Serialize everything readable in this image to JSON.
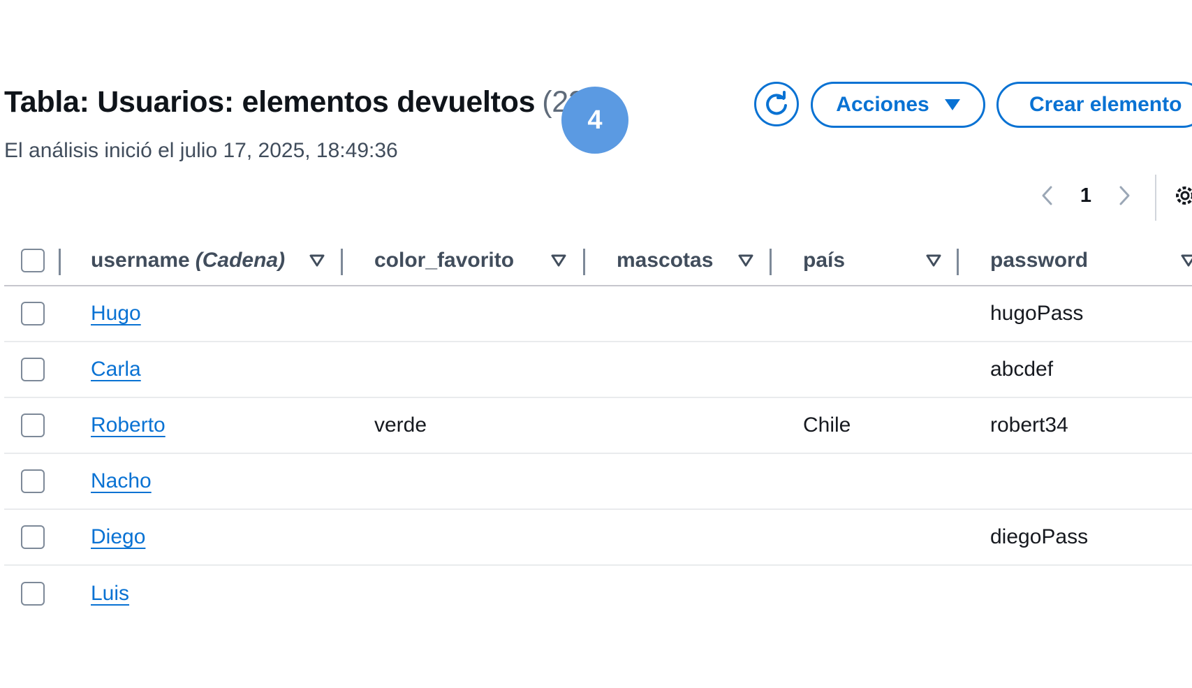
{
  "header": {
    "title": "Tabla: Usuarios: elementos devueltos",
    "count": "(22)",
    "subtitle": "El análisis inició el julio 17, 2025, 18:49:36"
  },
  "step_badge": "4",
  "toolbar": {
    "refresh_icon": "refresh-icon",
    "actions_label": "Acciones",
    "create_label": "Crear elemento"
  },
  "pagination": {
    "current_page": "1",
    "settings_icon": "gear-icon"
  },
  "table": {
    "columns": [
      {
        "label": "username",
        "type": "(Cadena)"
      },
      {
        "label": "color_favorito"
      },
      {
        "label": "mascotas"
      },
      {
        "label": "país"
      },
      {
        "label": "password"
      }
    ],
    "rows": [
      {
        "username": "Hugo",
        "color_favorito": "",
        "mascotas": "",
        "pais": "",
        "password": "hugoPass"
      },
      {
        "username": "Carla",
        "color_favorito": "",
        "mascotas": "",
        "pais": "",
        "password": "abcdef"
      },
      {
        "username": "Roberto",
        "color_favorito": "verde",
        "mascotas": "",
        "pais": "Chile",
        "password": "robert34"
      },
      {
        "username": "Nacho",
        "color_favorito": "",
        "mascotas": "",
        "pais": "",
        "password": ""
      },
      {
        "username": "Diego",
        "color_favorito": "",
        "mascotas": "",
        "pais": "",
        "password": "diegoPass"
      },
      {
        "username": "Luis",
        "color_favorito": "",
        "mascotas": "",
        "pais": "",
        "password": ""
      }
    ]
  },
  "colors": {
    "link": "#0972d3",
    "badge": "#5b9ae2",
    "text": "#16191f"
  }
}
